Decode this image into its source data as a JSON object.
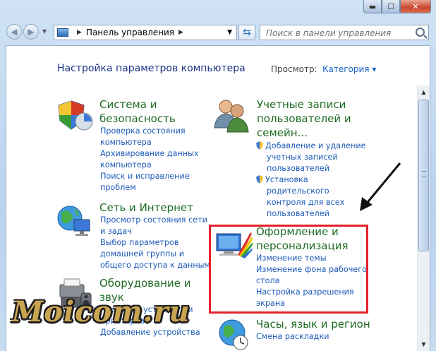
{
  "window": {
    "caption_buttons": {
      "minimize": "▬",
      "maximize": "☐",
      "close": "✕"
    }
  },
  "toolbar": {
    "back_symbol": "◀",
    "forward_symbol": "▶",
    "breadcrumb": "Панель управления",
    "search_placeholder": "Поиск в панели управления"
  },
  "content": {
    "heading": "Настройка параметров компьютера",
    "view_label": "Просмотр:",
    "view_value": "Категория"
  },
  "categories": [
    {
      "title": [
        "Система и",
        "безопасность"
      ],
      "links": [
        "Проверка состояния",
        "компьютера",
        "Архивирование данных",
        "компьютера",
        "Поиск и исправление",
        "проблем"
      ]
    },
    {
      "title": [
        "Сеть и Интернет"
      ],
      "links": [
        "Просмотр состояния сети",
        "и задач",
        "Выбор параметров",
        "домашней группы и",
        "общего доступа к данным"
      ]
    },
    {
      "title": [
        "Оборудование и",
        "звук"
      ],
      "links": [
        "Просмотр устройств и",
        "принтеров",
        "Добавление устройства"
      ]
    },
    {
      "title": [
        "Учетные записи",
        "пользователей и",
        "семейн..."
      ],
      "links": [
        "Добавление и удаление",
        "учетных записей",
        "пользователей",
        "Установка",
        "родительского",
        "контроля для всех",
        "пользователей"
      ]
    },
    {
      "title": [
        "Оформление и",
        "персонализация"
      ],
      "links": [
        "Изменение темы",
        "Изменение фона рабочего",
        "стола",
        "Настройка разрешения",
        "экрана"
      ]
    },
    {
      "title": [
        "Часы, язык и регион"
      ],
      "links": [
        "Смена раскладки"
      ]
    }
  ],
  "watermark": "Moicom.ru",
  "colors": {
    "highlight_box": "#e4222b",
    "category_title": "#1e6b23",
    "link": "#1c5ab8",
    "heading": "#1e3287"
  }
}
